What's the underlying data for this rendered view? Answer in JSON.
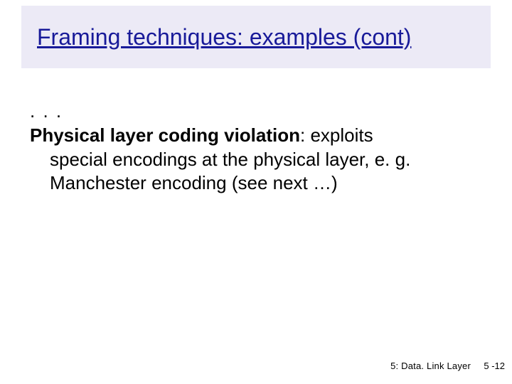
{
  "title": "Framing techniques: examples (cont)",
  "body": {
    "leader": ". . .",
    "heading": "Physical layer coding violation",
    "rest1": ": exploits",
    "rest2": "special encodings at the physical layer, e. g.",
    "rest3": "Manchester encoding (see next …)"
  },
  "footer": {
    "section": "5: Data. Link Layer",
    "page": "5 -12"
  }
}
